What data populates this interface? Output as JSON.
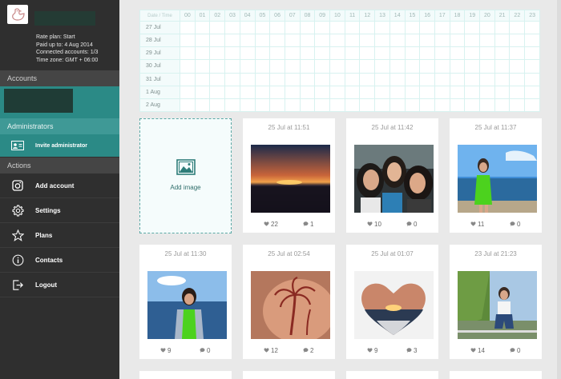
{
  "profile": {
    "plan_lines": [
      "Rate plan: Start",
      "Paid up to: 4 Aug 2014",
      "Connected accounts: 1/3",
      "Time zone: GMT + 06:00"
    ]
  },
  "sidebar": {
    "accounts_heading": "Accounts",
    "administrators_heading": "Administrators",
    "invite_label": "Invite administrator",
    "actions_heading": "Actions",
    "menu": [
      {
        "label": "Add account",
        "icon": "instagram-icon"
      },
      {
        "label": "Settings",
        "icon": "gear-icon"
      },
      {
        "label": "Plans",
        "icon": "star-icon"
      },
      {
        "label": "Contacts",
        "icon": "info-icon"
      },
      {
        "label": "Logout",
        "icon": "logout-icon"
      }
    ]
  },
  "schedule": {
    "corner": "Date / Time",
    "hours": [
      "00",
      "01",
      "02",
      "03",
      "04",
      "05",
      "06",
      "07",
      "08",
      "09",
      "10",
      "11",
      "12",
      "13",
      "14",
      "15",
      "16",
      "17",
      "18",
      "19",
      "20",
      "21",
      "22",
      "23"
    ],
    "days": [
      "27 Jul",
      "28 Jul",
      "29 Jul",
      "30 Jul",
      "31 Jul",
      "1 Aug",
      "2 Aug"
    ]
  },
  "add_image_label": "Add image",
  "posts": [
    {
      "date": "25 Jul at 11:51",
      "likes": "22",
      "comments": "1",
      "photo": "sunset-lake"
    },
    {
      "date": "25 Jul at 11:42",
      "likes": "10",
      "comments": "0",
      "photo": "three-girls-selfie"
    },
    {
      "date": "25 Jul at 11:37",
      "likes": "11",
      "comments": "0",
      "photo": "girl-green-dress-sea"
    },
    {
      "date": "25 Jul at 11:30",
      "likes": "9",
      "comments": "0",
      "photo": "girl-jacket-sea"
    },
    {
      "date": "25 Jul at 02:54",
      "likes": "12",
      "comments": "2",
      "photo": "palm-tree-tattoo"
    },
    {
      "date": "25 Jul at 01:07",
      "likes": "9",
      "comments": "3",
      "photo": "heart-sunset"
    },
    {
      "date": "23 Jul at 21:23",
      "likes": "14",
      "comments": "0",
      "photo": "girl-sitting-trees"
    }
  ],
  "colors": {
    "accent": "#2b8a86",
    "sidebar": "#2f2f2f"
  }
}
